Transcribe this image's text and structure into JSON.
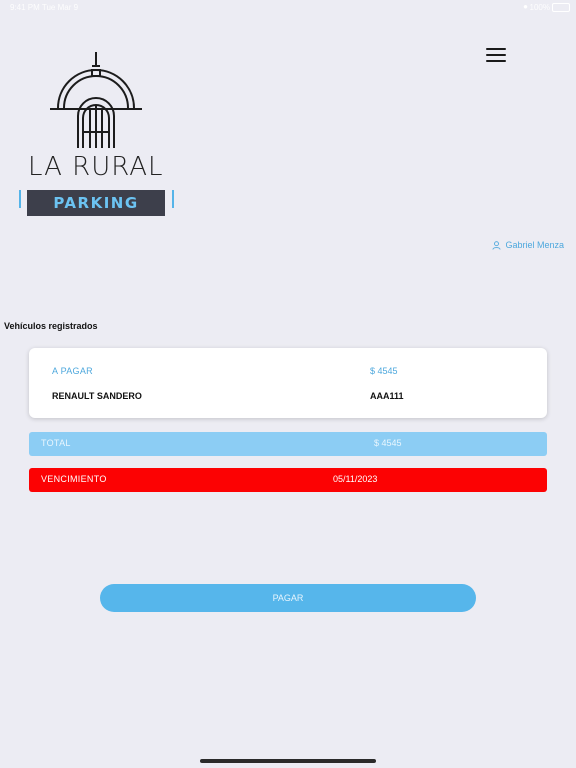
{
  "status_bar": {
    "time": "9:41 PM  Tue Mar 9",
    "battery": "100%"
  },
  "brand": {
    "name": "LA RURAL",
    "product": "PARKING"
  },
  "user": {
    "name": "Gabriel Menza"
  },
  "section_title": "Vehículos registrados",
  "vehicle_card": {
    "pay_label": "A PAGAR",
    "pay_amount": "$ 4545",
    "vehicle": "RENAULT SANDERO",
    "plate": "AAA111"
  },
  "total": {
    "label": "TOTAL",
    "amount": "$ 4545"
  },
  "due": {
    "label": "VENCIMIENTO",
    "date": "05/11/2023"
  },
  "pay_button": "PAGAR",
  "colors": {
    "accent": "#56b6eb",
    "total_bg": "#8ccdf4",
    "due_bg": "#fc0203",
    "parking_bg": "#3d3f4b"
  },
  "icons": {
    "menu": "hamburger-menu-icon",
    "user": "user-icon",
    "logo": "la-rural-building-icon"
  }
}
